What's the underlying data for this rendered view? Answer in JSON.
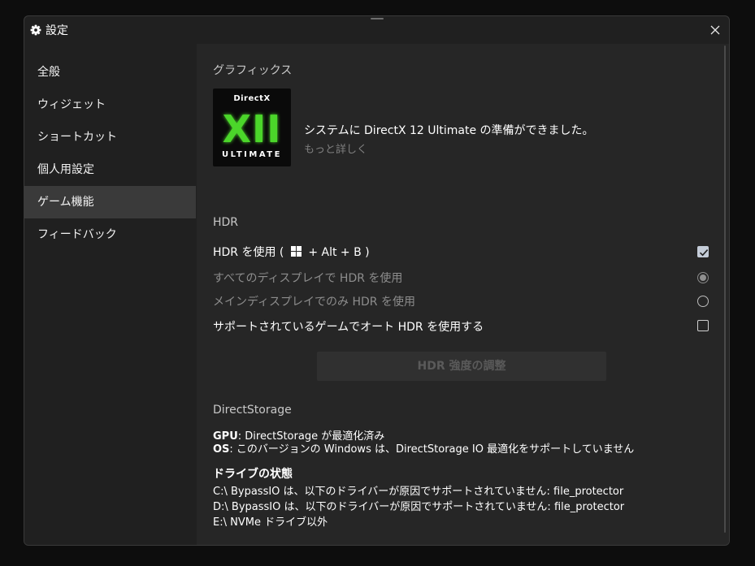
{
  "window": {
    "title": "設定",
    "title_icon": "gear-icon",
    "close_icon": "close-icon"
  },
  "sidebar": {
    "items": [
      {
        "label": "全般"
      },
      {
        "label": "ウィジェット"
      },
      {
        "label": "ショートカット"
      },
      {
        "label": "個人用設定"
      },
      {
        "label": "ゲーム機能",
        "active": true
      },
      {
        "label": "フィードバック"
      }
    ]
  },
  "graphics": {
    "section_title": "グラフィックス",
    "logo_text_top": "DirectX",
    "logo_text_mark": "XII",
    "logo_text_bottom": "ULTIMATE",
    "logo_accent": "#4cd62b",
    "ready_text": "システムに DirectX 12 Ultimate の準備ができました。",
    "more_link": "もっと詳しく"
  },
  "hdr": {
    "section_title": "HDR",
    "use_hdr_prefix": "HDR を使用 (",
    "use_hdr_suffix": "+ Alt + B )",
    "use_hdr_checked": true,
    "all_displays_label": "すべてのディスプレイで HDR を使用",
    "all_displays_selected": true,
    "main_display_label": "メインディスプレイでのみ HDR を使用",
    "main_display_selected": false,
    "auto_hdr_label": "サポートされているゲームでオート HDR を使用する",
    "auto_hdr_checked": false,
    "adjust_button": "HDR 強度の調整"
  },
  "directstorage": {
    "section_title": "DirectStorage",
    "gpu_key": "GPU",
    "gpu_value": ": DirectStorage が最適化済み",
    "os_key": "OS",
    "os_value": ": このバージョンの Windows は、DirectStorage IO 最適化をサポートしていません",
    "drive_heading": "ドライブの状態",
    "drives": [
      "C:\\ BypassIO は、以下のドライバーが原因でサポートされていません: file_protector",
      "D:\\ BypassIO は、以下のドライバーが原因でサポートされていません: file_protector",
      "E:\\ NVMe ドライブ以外"
    ]
  }
}
